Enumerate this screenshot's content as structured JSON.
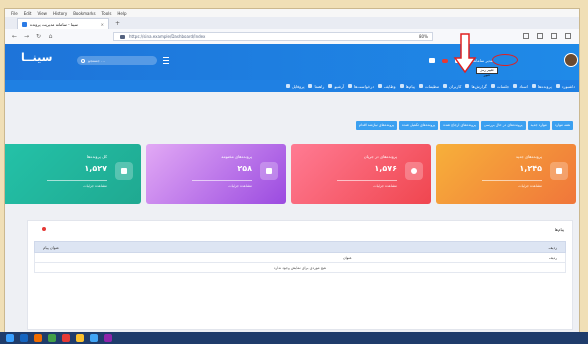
{
  "browser": {
    "menu": [
      "File",
      "Edit",
      "View",
      "History",
      "Bookmarks",
      "Tools",
      "Help"
    ],
    "tab_title": "سینا - سامانه مدیریت پرونده",
    "address": "https://sina.example/Dashboard/Index",
    "zoom": "80%"
  },
  "app": {
    "logo": "سینــا",
    "search_placeholder": "جستجو ...",
    "username": "مدیر سامانه",
    "tooltip": "تغییر رمز عبور",
    "nav": [
      "داشبورد",
      "پرونده‌ها",
      "اسناد",
      "جلسات",
      "گزارش‌ها",
      "کاربران",
      "تنظیمات",
      "پیام‌ها",
      "وظایف",
      "درخواست‌ها",
      "آرشیو",
      "راهنما",
      "پروفایل"
    ],
    "chips": [
      "همه موارد",
      "موارد جدید",
      "پرونده‌های در حال بررسی",
      "پرونده‌های ارجاع شده",
      "پرونده‌های تکمیل شده",
      "پرونده‌های نیازمند اقدام"
    ]
  },
  "cards": [
    {
      "title": "پرونده‌های جدید",
      "value": "۱,۲۴۵",
      "sub": "مشاهده جزئیات",
      "color_from": "#f7b03a",
      "color_to": "#f0763a"
    },
    {
      "title": "پرونده‌های در جریان",
      "value": "۱,۵۷۶",
      "sub": "مشاهده جزئیات",
      "color_from": "#ff7b93",
      "color_to": "#f0464f"
    },
    {
      "title": "پرونده‌های مختومه",
      "value": "۲۵۸",
      "sub": "مشاهده جزئیات",
      "color_from": "#e2a9f5",
      "color_to": "#9b4be0"
    },
    {
      "title": "کل پرونده‌ها",
      "value": "۱,۵۲۷",
      "sub": "مشاهده جزئیات",
      "color_from": "#24c2a8",
      "color_to": "#1fa991"
    }
  ],
  "panel": {
    "title": "پیام‌ها",
    "col1": "ردیف",
    "col2": "عنوان پیام",
    "sub1": "ردیف",
    "sub2": "عنوان",
    "empty": "هیچ موردی برای نمایش وجود ندارد"
  },
  "colors": {
    "header": "#1e74d9",
    "nav": "#1f80e3",
    "chip": "#3ba0f0",
    "annotation": "#e02020"
  }
}
